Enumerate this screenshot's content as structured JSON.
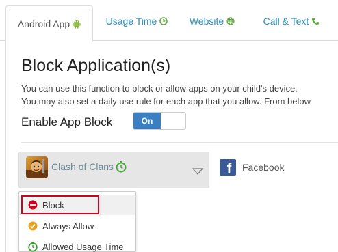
{
  "tabs": [
    {
      "label": "Android App",
      "icon": "android-icon",
      "active": true
    },
    {
      "label": "Usage Time",
      "icon": "clock-icon",
      "active": false
    },
    {
      "label": "Website",
      "icon": "globe-icon",
      "active": false
    },
    {
      "label": "Call & Text",
      "icon": "phone-icon",
      "active": false
    }
  ],
  "main": {
    "title": "Block Application(s)",
    "description_line1": "You can use this function to block or allow apps on your child's device.",
    "description_line2": "You may also set a daily use rule for each app that you allow. From below",
    "enable_label": "Enable App Block",
    "toggle_state": "On"
  },
  "apps": [
    {
      "name": "Clash of Clans",
      "icon": "clash-of-clans-icon",
      "status_icon": "timer-icon"
    },
    {
      "name": "Facebook",
      "icon": "facebook-icon"
    }
  ],
  "menu": {
    "items": [
      {
        "label": "Block",
        "icon": "block-icon",
        "color": "#d0021b"
      },
      {
        "label": "Always Allow",
        "icon": "check-circle-icon",
        "color": "#e8a21b"
      },
      {
        "label": "Allowed Usage Time",
        "icon": "timer-icon",
        "color": "#3a9a2f"
      }
    ]
  },
  "colors": {
    "accent": "#2a8fbd",
    "toggle": "#3a7fc2",
    "highlight": "#d0021b"
  }
}
